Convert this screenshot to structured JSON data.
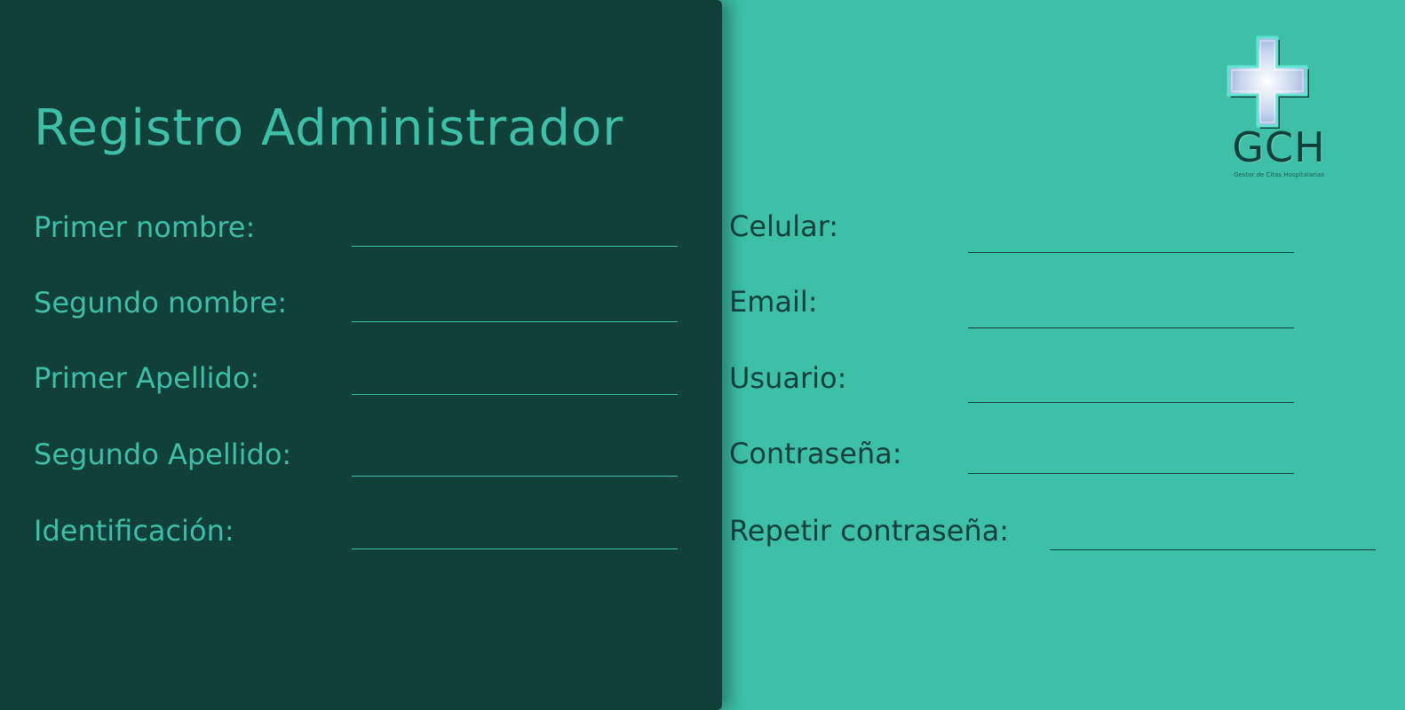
{
  "title": "Registro Administrador",
  "left_fields": [
    {
      "label": "Primer nombre:",
      "value": ""
    },
    {
      "label": "Segundo nombre:",
      "value": ""
    },
    {
      "label": "Primer Apellido:",
      "value": ""
    },
    {
      "label": "Segundo Apellido:",
      "value": ""
    },
    {
      "label": "Identificación:",
      "value": ""
    }
  ],
  "right_fields": [
    {
      "label": "Celular:",
      "value": ""
    },
    {
      "label": "Email:",
      "value": ""
    },
    {
      "label": "Usuario:",
      "value": ""
    },
    {
      "label": "Contraseña:",
      "value": ""
    },
    {
      "label": "Repetir contraseña:",
      "value": ""
    }
  ],
  "logo": {
    "text": "GCH",
    "subtitle": "Gestor de Citas Hospitalarias",
    "icon": "medical-cross-icon"
  },
  "colors": {
    "dark_panel": "#113f3a",
    "accent": "#3ebfa8",
    "cross": "#c9d6ee"
  }
}
